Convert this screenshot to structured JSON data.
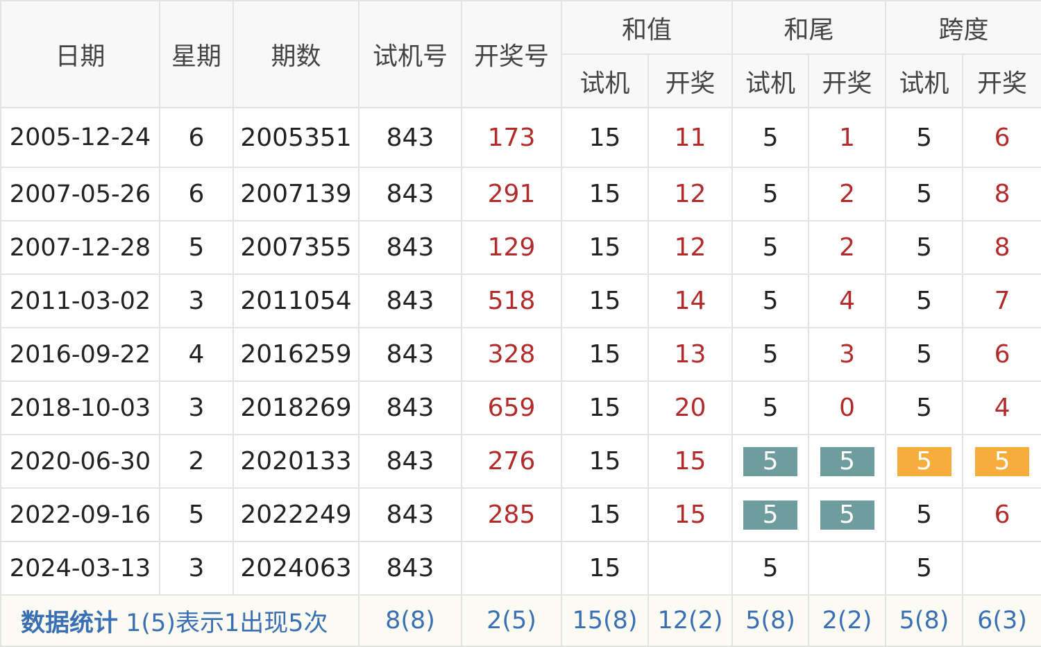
{
  "headers": {
    "date": "日期",
    "weekday": "星期",
    "issue": "期数",
    "trial": "试机号",
    "draw": "开奖号",
    "sum": "和值",
    "tail": "和尾",
    "span": "跨度",
    "sub_trial": "试机",
    "sub_draw": "开奖"
  },
  "rows": [
    {
      "date": "2005-12-24",
      "weekday": "6",
      "issue": "2005351",
      "trial": "843",
      "draw": "173",
      "sum_trial": "15",
      "sum_draw": "11",
      "tail_trial": "5",
      "tail_draw": "1",
      "span_trial": "5",
      "span_draw": "6"
    },
    {
      "date": "2007-05-26",
      "weekday": "6",
      "issue": "2007139",
      "trial": "843",
      "draw": "291",
      "sum_trial": "15",
      "sum_draw": "12",
      "tail_trial": "5",
      "tail_draw": "2",
      "span_trial": "5",
      "span_draw": "8"
    },
    {
      "date": "2007-12-28",
      "weekday": "5",
      "issue": "2007355",
      "trial": "843",
      "draw": "129",
      "sum_trial": "15",
      "sum_draw": "12",
      "tail_trial": "5",
      "tail_draw": "2",
      "span_trial": "5",
      "span_draw": "8"
    },
    {
      "date": "2011-03-02",
      "weekday": "3",
      "issue": "2011054",
      "trial": "843",
      "draw": "518",
      "sum_trial": "15",
      "sum_draw": "14",
      "tail_trial": "5",
      "tail_draw": "4",
      "span_trial": "5",
      "span_draw": "7"
    },
    {
      "date": "2016-09-22",
      "weekday": "4",
      "issue": "2016259",
      "trial": "843",
      "draw": "328",
      "sum_trial": "15",
      "sum_draw": "13",
      "tail_trial": "5",
      "tail_draw": "3",
      "span_trial": "5",
      "span_draw": "6"
    },
    {
      "date": "2018-10-03",
      "weekday": "3",
      "issue": "2018269",
      "trial": "843",
      "draw": "659",
      "sum_trial": "15",
      "sum_draw": "20",
      "tail_trial": "5",
      "tail_draw": "0",
      "span_trial": "5",
      "span_draw": "4"
    },
    {
      "date": "2020-06-30",
      "weekday": "2",
      "issue": "2020133",
      "trial": "843",
      "draw": "276",
      "sum_trial": "15",
      "sum_draw": "15",
      "tail_trial": "5",
      "tail_draw": "5",
      "span_trial": "5",
      "span_draw": "5"
    },
    {
      "date": "2022-09-16",
      "weekday": "5",
      "issue": "2022249",
      "trial": "843",
      "draw": "285",
      "sum_trial": "15",
      "sum_draw": "15",
      "tail_trial": "5",
      "tail_draw": "5",
      "span_trial": "5",
      "span_draw": "6"
    },
    {
      "date": "2024-03-13",
      "weekday": "3",
      "issue": "2024063",
      "trial": "843",
      "draw": "",
      "sum_trial": "15",
      "sum_draw": "",
      "tail_trial": "5",
      "tail_draw": "",
      "span_trial": "5",
      "span_draw": ""
    }
  ],
  "footer": {
    "label": "数据统计",
    "note": "1(5)表示1出现5次",
    "trial": "8(8)",
    "draw": "2(5)",
    "sum_trial": "15(8)",
    "sum_draw": "12(2)",
    "tail_trial": "5(8)",
    "tail_draw": "2(2)",
    "span_trial": "5(8)",
    "span_draw": "6(3)"
  },
  "colors": {
    "draw_text": "#b22a2a",
    "tail_highlight": "#6f9c9c",
    "span_highlight": "#f6ad3b",
    "footer_text": "#3a6fb3"
  }
}
